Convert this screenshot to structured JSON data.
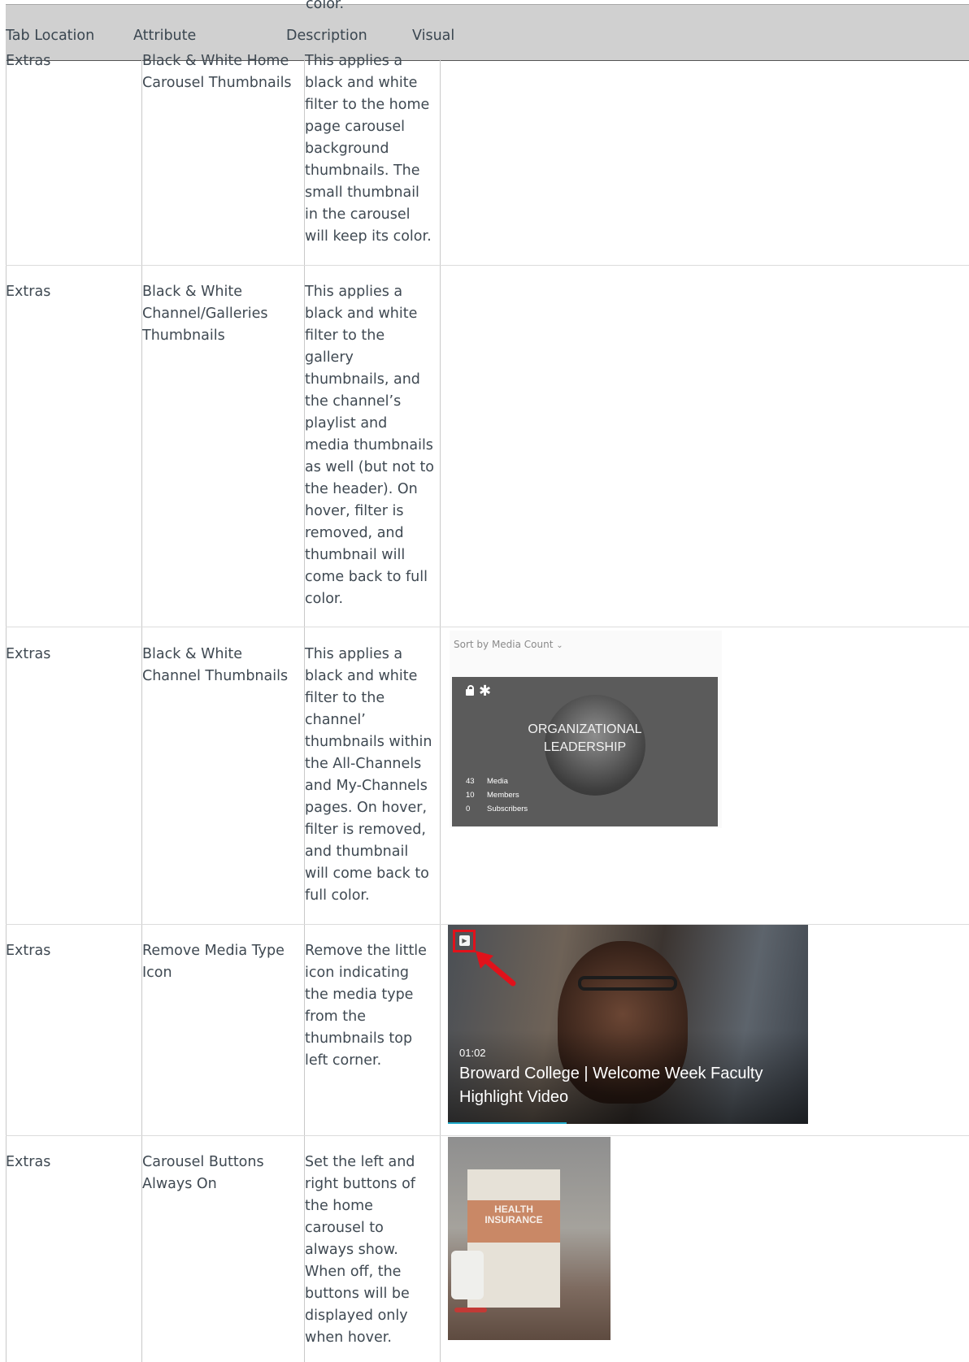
{
  "header": {
    "overflow_text": "color.",
    "columns": [
      "Tab Location",
      "Attribute",
      "Description",
      "Visual"
    ]
  },
  "rows": [
    {
      "tab": "Extras",
      "attribute": "Black & White Home\nCarousel Thumbnails",
      "description": "This applies a\nblack and white\nfilter to the home\npage carousel\nbackground\nthumbnails. The\nsmall thumbnail\nin the carousel\nwill keep its color."
    },
    {
      "tab": "Extras",
      "attribute": "Black & White\nChannel/Galleries\nThumbnails",
      "description": "This applies a\nblack and white\nfilter to the\ngallery\nthumbnails, and\nthe channel’s\nplaylist and\nmedia thumbnails\nas well (but not to\nthe header). On\nhover, filter is\nremoved, and\nthumbnail will\ncome back to full\ncolor."
    },
    {
      "tab": "Extras",
      "attribute": "Black & White\nChannel Thumbnails",
      "description": "This applies a\nblack and white\nfilter to the\nchannel’\nthumbnails within\nthe All-Channels\nand My-Channels\npages. On hover,\nfilter is removed,\nand thumbnail\nwill come back to\nfull color."
    },
    {
      "tab": "Extras",
      "attribute": "Remove Media Type\nIcon",
      "description": "Remove the little\nicon indicating\nthe media type\nfrom the\nthumbnails top\nleft corner."
    },
    {
      "tab": "Extras",
      "attribute": "Carousel Buttons\nAlways On",
      "description": "Set the left and\nright buttons of\nthe home\ncarousel to\nalways show.\nWhen off, the\nbuttons will be\ndisplayed only\nwhen hover."
    }
  ],
  "visual_channel": {
    "sort_label": "Sort by Media Count",
    "title": "ORGANIZATIONAL\nLEADERSHIP",
    "stats": [
      {
        "count": "43",
        "label": "Media"
      },
      {
        "count": "10",
        "label": "Members"
      },
      {
        "count": "0",
        "label": "Subscribers"
      }
    ],
    "icons": [
      "lock-icon",
      "asterisk-icon"
    ]
  },
  "visual_media": {
    "duration": "01:02",
    "title": "Broward College | Welcome Week Faculty\nHighlight Video",
    "progress": 0.33,
    "media_type_icon": "youtube-icon",
    "highlight_color": "#e0121b"
  },
  "visual_carousel": {
    "banner_text": "HEALTH\nINSURANCE"
  }
}
